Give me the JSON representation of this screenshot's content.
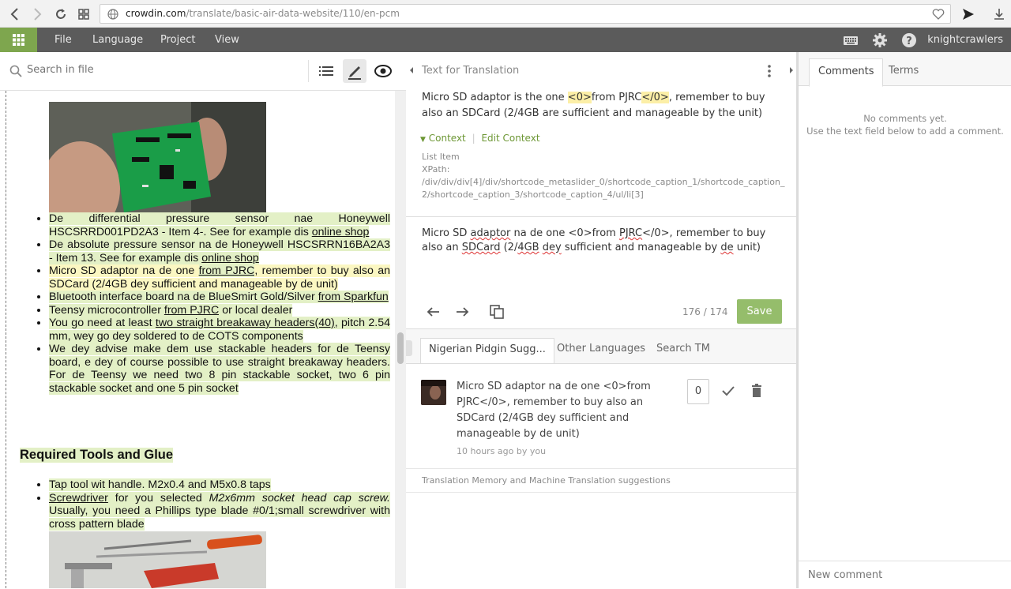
{
  "browser": {
    "url_host": "crowdin.com",
    "url_path": "/translate/basic-air-data-website/110/en-pcm"
  },
  "menu": {
    "items": [
      "File",
      "Language",
      "Project",
      "View"
    ],
    "username": "knightcrawlers"
  },
  "left": {
    "search_placeholder": "Search in file",
    "list1": [
      {
        "parts": [
          [
            "hl",
            "De differential pressure sensor nae Honeywell HSCSRRD001PD2A3 - Item 4-. "
          ],
          [
            "hl",
            "See for example dis "
          ],
          [
            "link",
            "online shop"
          ]
        ]
      },
      {
        "parts": [
          [
            "hl",
            "De absolute pressure sensor na de Honeywell HSCSRRN16BA2A3 - Item 13.  "
          ],
          [
            "hl",
            "See for example dis "
          ],
          [
            "link",
            "online shop"
          ]
        ]
      },
      {
        "parts": [
          [
            "hly",
            "Micro SD adaptor na de one "
          ],
          [
            "link",
            "from PJRC"
          ],
          [
            "hly",
            ", remember to buy also an SDCard (2/4GB dey sufficient and manageable by de unit)"
          ]
        ]
      },
      {
        "parts": [
          [
            "hl",
            "Bluetooth interface board na de BlueSmirt Gold/Silver "
          ],
          [
            "link",
            "from Sparkfun"
          ]
        ]
      },
      {
        "parts": [
          [
            "hl",
            "Teensy microcontroller "
          ],
          [
            "link",
            "from PJRC"
          ],
          [
            "hl",
            " or local dealer"
          ]
        ]
      },
      {
        "parts": [
          [
            "hl",
            "You go need at least "
          ],
          [
            "link",
            "two straight breakaway headers(40)"
          ],
          [
            "hl",
            ", pitch 2.54 mm, wey go dey soldered to de COTS components"
          ]
        ]
      },
      {
        "parts": [
          [
            "hl",
            "We dey advise make dem use stackable headers for de Teensy board, e dey of course possible to use straight breakaway headers. "
          ],
          [
            "hl",
            "For de Teensy we need two 8 pin stackable socket, two 6 pin stackable socket and one 5 pin socket"
          ]
        ]
      }
    ],
    "heading": "Required Tools and Glue",
    "list2": [
      {
        "parts": [
          [
            "hl",
            "Tap tool wit handle.  M2x0.4 and M5x0.8 taps"
          ]
        ]
      },
      {
        "parts": [
          [
            "link",
            "Screwdriver"
          ],
          [
            "hl",
            " for you selected "
          ],
          [
            "em",
            "M2x6mm socket head cap screw."
          ],
          [
            "hl",
            " Usually, you need a Phillips type blade #0/1;small screwdriver with cross pattern blade"
          ]
        ]
      }
    ]
  },
  "middle": {
    "header_title": "Text for Translation",
    "source_before": "Micro SD adaptor is the one ",
    "source_tag1": "<0>",
    "source_mid": "from PJRC",
    "source_tag2": "</0>",
    "source_after": ", remember to buy also an SDCard (2/4GB are sufficient and manageable by the unit)",
    "context_label": "Context",
    "edit_context_label": "Edit Context",
    "context_type": "List Item",
    "xpath_label": "XPath:",
    "xpath": "/div/div/div[4]/div/shortcode_metaslider_0/shortcode_caption_1/shortcode_caption_2/shortcode_caption_3/shortcode_caption_4/ul/li[3]",
    "translation": [
      [
        "t",
        "Micro SD "
      ],
      [
        "sq",
        "adaptor"
      ],
      [
        "t",
        " na de one <0>from "
      ],
      [
        "sq",
        "PJRC"
      ],
      [
        "t",
        "</0>, remember to buy also an "
      ],
      [
        "sq",
        "SDCard"
      ],
      [
        "t",
        " (2/"
      ],
      [
        "sq",
        "4GB"
      ],
      [
        "t",
        " "
      ],
      [
        "sq",
        "dey"
      ],
      [
        "t",
        " sufficient and manageable by "
      ],
      [
        "sq",
        "de"
      ],
      [
        "t",
        " unit)"
      ]
    ],
    "counter": "176 / 174",
    "save_label": "Save",
    "tabs": [
      "Nigerian Pidgin Sugg...",
      "Other Languages",
      "Search TM"
    ],
    "suggestion_text": "Micro SD adaptor na de one <0>from PJRC</0>, remember to buy also an SDCard (2/4GB dey sufficient and manageable by de unit)",
    "suggestion_meta": "10 hours ago by you",
    "suggestion_votes": "0",
    "tm_note": "Translation Memory and Machine Translation suggestions"
  },
  "right": {
    "tabs": [
      "Comments",
      "Terms"
    ],
    "no_comments_line1": "No comments yet.",
    "no_comments_line2": "Use the text field below to add a comment.",
    "new_comment_placeholder": "New comment"
  }
}
